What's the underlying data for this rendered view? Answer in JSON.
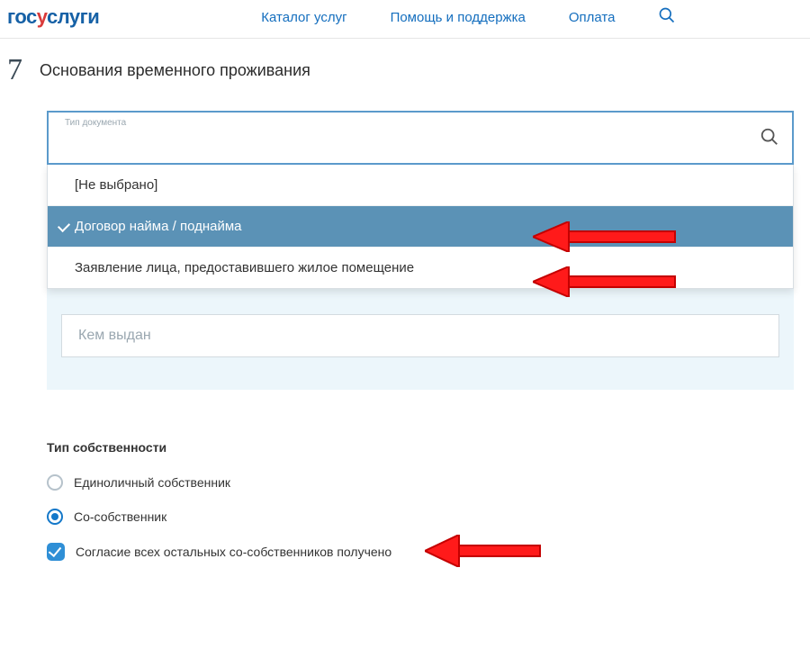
{
  "header": {
    "logo_parts": {
      "a": "гос",
      "b": "у",
      "c": "слуги"
    },
    "nav": {
      "catalog": "Каталог услуг",
      "help": "Помощь и поддержка",
      "payment": "Оплата"
    }
  },
  "step": {
    "number": "7",
    "title": "Основания временного проживания"
  },
  "select": {
    "label": "Тип документа",
    "options": {
      "none": "[Не выбрано]",
      "rent": "Договор найма / поднайма",
      "statement": "Заявление лица, предоставившего жилое помещение"
    }
  },
  "issued_placeholder": "Кем выдан",
  "ownership": {
    "title": "Тип собственности",
    "sole": "Единоличный собственник",
    "co": "Со-собственник",
    "consent": "Согласие всех остальных со-собственников получено"
  }
}
